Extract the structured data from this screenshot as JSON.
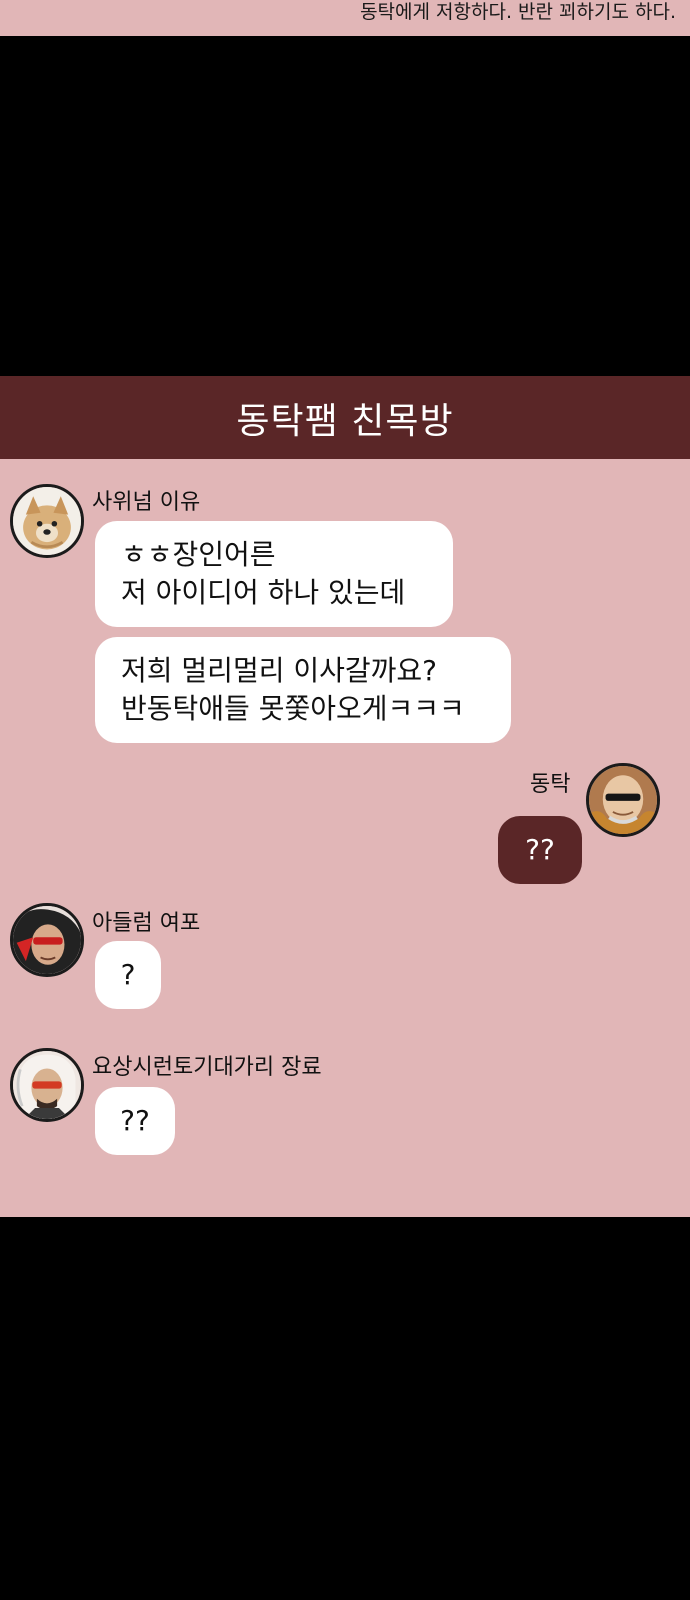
{
  "caption": "동탁에게 저항하다. 반란 꾀하기도 하다.",
  "chat": {
    "title": "동탁팸 친목방",
    "messages": [
      {
        "sender": "사위넘 이유",
        "avatar_icon": "yorkie-dog-avatar-icon",
        "bubbles": [
          {
            "lines": [
              "ㅎㅎ장인어른",
              "저 아이디어 하나 있는데"
            ]
          },
          {
            "lines": [
              "저희 멀리멀리 이사갈까요?",
              "반동탁애들 못쫓아오게ㅋㅋㅋ"
            ]
          }
        ]
      },
      {
        "sender": "동탁",
        "avatar_icon": "bald-man-sunglasses-avatar-icon",
        "mine": true,
        "bubbles": [
          {
            "lines": [
              "??"
            ]
          }
        ]
      },
      {
        "sender": "아들럼 여포",
        "avatar_icon": "red-visor-warrior-avatar-icon",
        "bubbles": [
          {
            "lines": [
              "?"
            ]
          }
        ]
      },
      {
        "sender": "요상시런토기대가리 장료",
        "avatar_icon": "white-haired-sunglasses-avatar-icon",
        "bubbles": [
          {
            "lines": [
              "??"
            ]
          }
        ]
      }
    ]
  },
  "colors": {
    "chat_background": "#e1b6b7",
    "header_background": "#5a2627",
    "my_bubble": "#5a2627",
    "other_bubble": "#ffffff"
  }
}
